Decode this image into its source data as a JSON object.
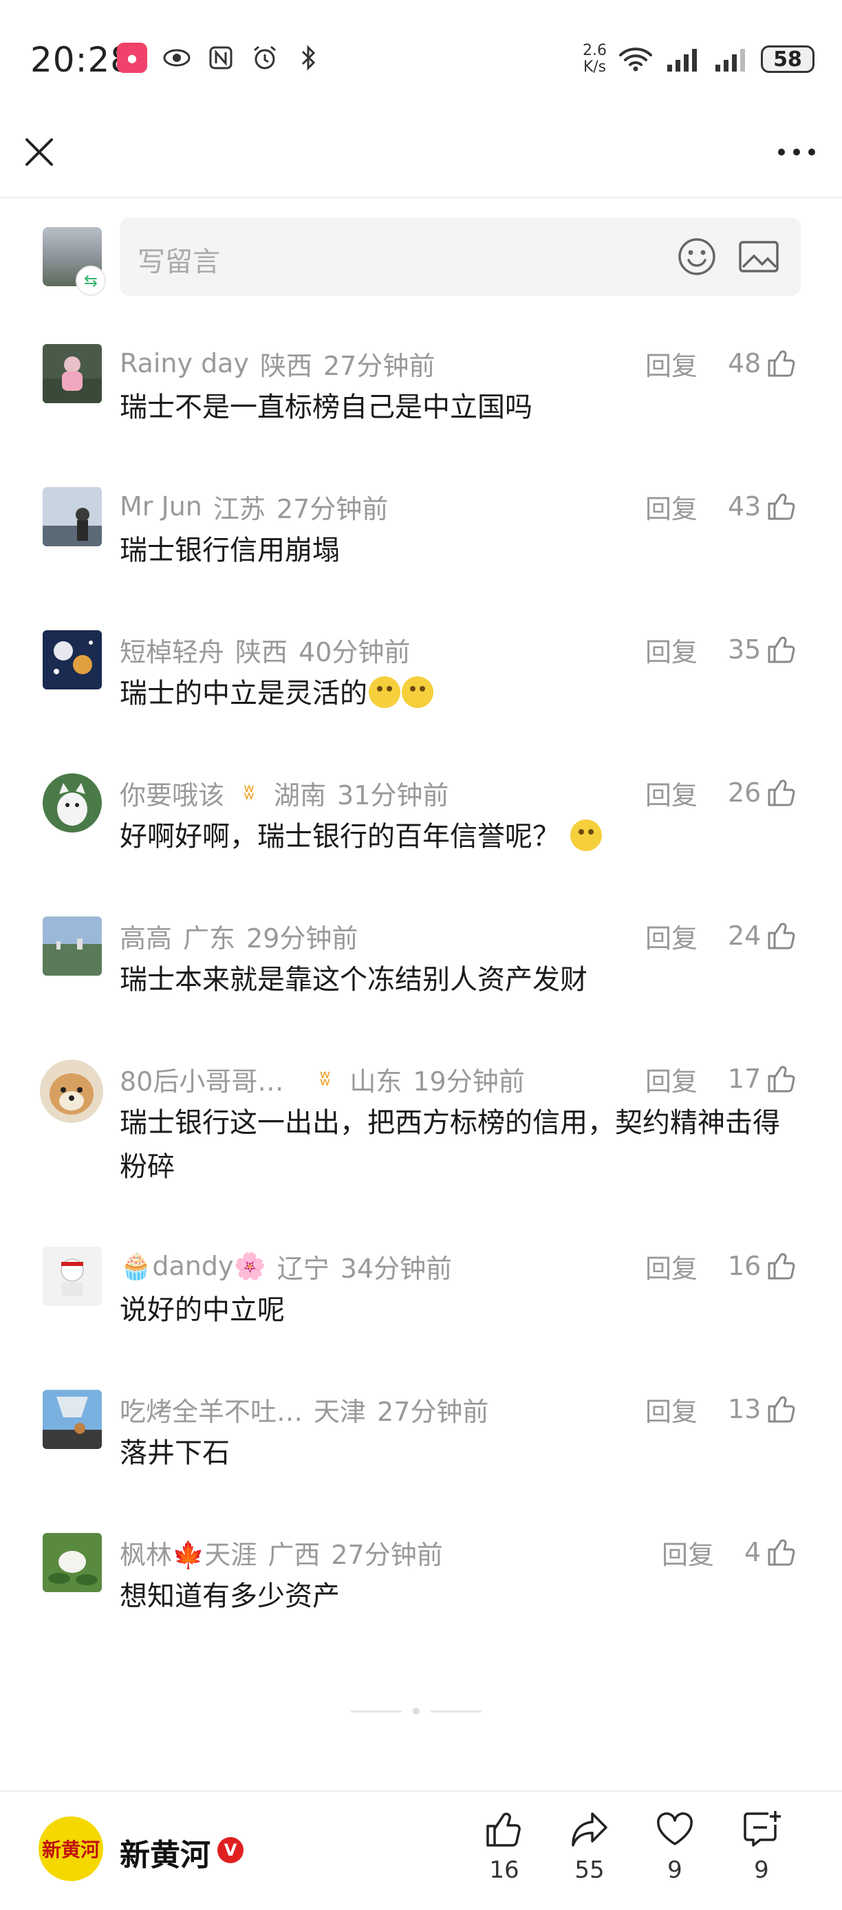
{
  "status_bar": {
    "time": "20:28",
    "netspeed_value": "2.6",
    "netspeed_unit": "K/s",
    "battery": "58"
  },
  "comment_input": {
    "placeholder": "写留言"
  },
  "comments": [
    {
      "name": "Rainy day",
      "location": "陕西",
      "time": "27分钟前",
      "reply": "回复",
      "likes": "48",
      "text": "瑞士不是一直标榜自己是中立国吗"
    },
    {
      "name": "Mr Jun",
      "location": "江苏",
      "time": "27分钟前",
      "reply": "回复",
      "likes": "43",
      "text": "瑞士银行信用崩塌"
    },
    {
      "name": "短棹轻舟",
      "location": "陕西",
      "time": "40分钟前",
      "reply": "回复",
      "likes": "35",
      "text": "瑞士的中立是灵活的"
    },
    {
      "name": "你要哦该",
      "location": "湖南",
      "time": "31分钟前",
      "reply": "回复",
      "likes": "26",
      "text": "好啊好啊，瑞士银行的百年信誉呢？"
    },
    {
      "name": "高高",
      "location": "广东",
      "time": "29分钟前",
      "reply": "回复",
      "likes": "24",
      "text": "瑞士本来就是靠这个冻结别人资产发财"
    },
    {
      "name": "80后小哥哥…",
      "location": "山东",
      "time": "19分钟前",
      "reply": "回复",
      "likes": "17",
      "text": "瑞士银行这一出出，把西方标榜的信用，契约精神击得粉碎"
    },
    {
      "name": "dandy",
      "location": "辽宁",
      "time": "34分钟前",
      "reply": "回复",
      "likes": "16",
      "text": "说好的中立呢"
    },
    {
      "name": "吃烤全羊不吐…",
      "location": "天津",
      "time": "27分钟前",
      "reply": "回复",
      "likes": "13",
      "text": "落井下石"
    },
    {
      "name": "枫林🍁天涯",
      "location": "广西",
      "time": "27分钟前",
      "reply": "回复",
      "likes": "4",
      "text": "想知道有多少资产"
    }
  ],
  "publisher": {
    "logo_text": "新黄河",
    "name": "新黄河",
    "verified_mark": "V"
  },
  "actions": {
    "like_count": "16",
    "share_count": "55",
    "favorite_count": "9",
    "comment_count": "9"
  },
  "colors": {
    "text_secondary": "#999999",
    "input_bg": "#f4f4f4",
    "verified": "#e02020",
    "logo_bg": "#f5d800"
  }
}
